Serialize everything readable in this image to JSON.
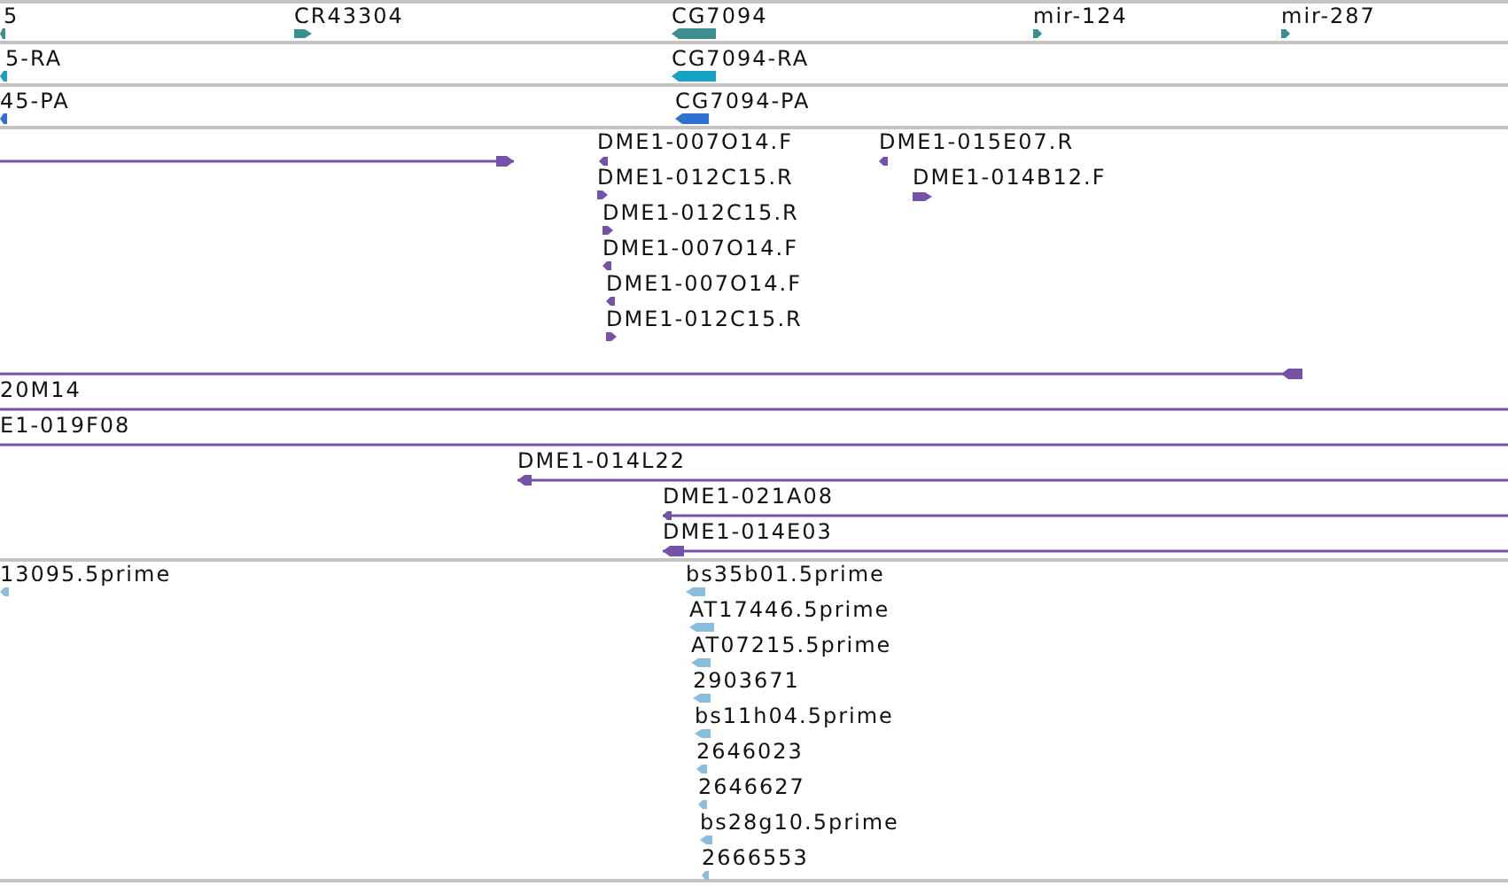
{
  "tracks": [
    {
      "color": "#3d8f8f",
      "features": [
        {
          "kind": "block",
          "label": "5",
          "reverse": true
        },
        {
          "kind": "block",
          "label": "CR43304",
          "reverse": false
        },
        {
          "kind": "block",
          "label": "CG7094",
          "reverse": true
        },
        {
          "kind": "block",
          "label": "mir-124",
          "reverse": false
        },
        {
          "kind": "block",
          "label": "mir-287",
          "reverse": false
        }
      ]
    },
    {
      "color": "#17a2c4",
      "features": [
        {
          "kind": "block",
          "label": "5-RA",
          "reverse": true
        },
        {
          "kind": "block",
          "label": "CG7094-RA",
          "reverse": true
        }
      ]
    },
    {
      "color": "#3070d0",
      "features": [
        {
          "kind": "block",
          "label": "45-PA",
          "reverse": true
        },
        {
          "kind": "block",
          "label": "CG7094-PA",
          "reverse": true
        }
      ]
    },
    {
      "color": "#7352a8",
      "features": [
        {
          "kind": "line",
          "reverse": false
        },
        {
          "kind": "block",
          "label": "DME1-007O14.F",
          "reverse": true
        },
        {
          "kind": "block",
          "label": "DME1-015E07.R",
          "reverse": true
        },
        {
          "kind": "block",
          "label": "DME1-012C15.R",
          "reverse": false
        },
        {
          "kind": "block",
          "label": "DME1-014B12.F",
          "reverse": false
        },
        {
          "kind": "block",
          "label": "DME1-012C15.R",
          "reverse": false
        },
        {
          "kind": "block",
          "label": "DME1-007O14.F",
          "reverse": true
        },
        {
          "kind": "block",
          "label": "DME1-007O14.F",
          "reverse": true
        },
        {
          "kind": "block",
          "label": "DME1-012C15.R",
          "reverse": false
        },
        {
          "kind": "line",
          "reverse": true
        },
        {
          "kind": "line",
          "label": "20M14"
        },
        {
          "kind": "line",
          "label": "E1-019F08"
        },
        {
          "kind": "line",
          "label": "DME1-014L22",
          "reverse": true
        },
        {
          "kind": "line",
          "label": "DME1-021A08",
          "reverse": true
        },
        {
          "kind": "line",
          "label": "DME1-014E03",
          "reverse": true
        }
      ]
    },
    {
      "color": "#88bde0",
      "features": [
        {
          "kind": "block",
          "label": "13095.5prime",
          "reverse": true
        },
        {
          "kind": "block",
          "label": "bs35b01.5prime",
          "reverse": true
        },
        {
          "kind": "block",
          "label": "AT17446.5prime",
          "reverse": true
        },
        {
          "kind": "block",
          "label": "AT07215.5prime",
          "reverse": true
        },
        {
          "kind": "block",
          "label": "2903671",
          "reverse": true
        },
        {
          "kind": "block",
          "label": "bs11h04.5prime",
          "reverse": true
        },
        {
          "kind": "block",
          "label": "2646023",
          "reverse": true
        },
        {
          "kind": "block",
          "label": "2646627",
          "reverse": true
        },
        {
          "kind": "block",
          "label": "bs28g10.5prime",
          "reverse": true
        },
        {
          "kind": "block",
          "label": "2666553",
          "reverse": true
        }
      ]
    }
  ]
}
